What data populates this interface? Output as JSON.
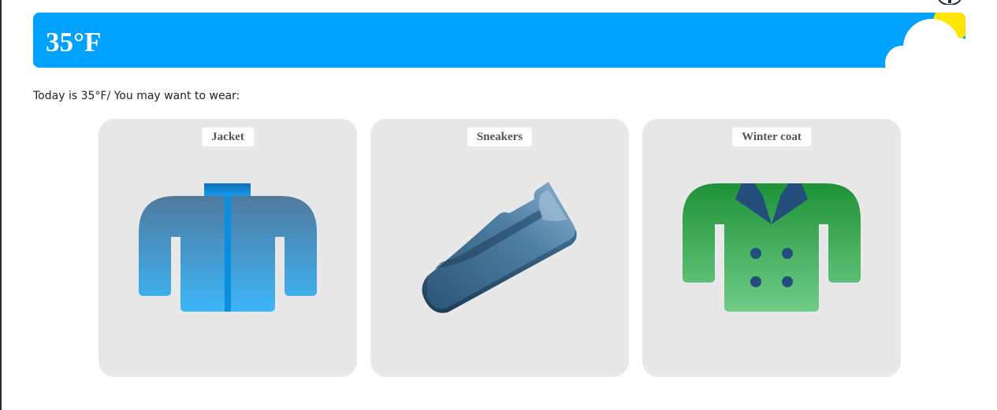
{
  "header": {
    "title": "35°F"
  },
  "intro": {
    "text": "Today is 35°F/ You may want to wear:"
  },
  "suggestions": [
    {
      "label": "Jacket",
      "icon": "jacket-icon"
    },
    {
      "label": "Sneakers",
      "icon": "sneaker-icon"
    },
    {
      "label": "Winter coat",
      "icon": "winter-coat-icon"
    }
  ],
  "colors": {
    "header_bg": "#00a2ff",
    "card_bg": "#e8e8e9",
    "jacket_top": "#4f7a9e",
    "jacket_bottom": "#3db6f8",
    "sneaker_dark": "#2c5475",
    "sneaker_light": "#8ab2cf",
    "coat_top": "#1f9238",
    "coat_bottom": "#6fcc87",
    "coat_lapel": "#234d7a"
  }
}
